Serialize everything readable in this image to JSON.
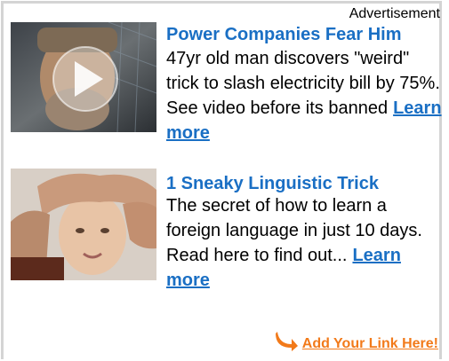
{
  "ad": {
    "label": "Advertisement",
    "items": [
      {
        "title": "Power Companies Fear Him",
        "body": "47yr old man discovers \"weird\" trick to slash electricity bill by 75%. See video before its banned",
        "cta": "Learn more",
        "thumbnail_icon": "play-icon"
      },
      {
        "title": "1 Sneaky Linguistic Trick",
        "body": "The secret of how to learn a foreign language in just 10 days. Read here to find out...",
        "cta": "Learn more"
      }
    ],
    "footer_link": "Add Your Link Here!"
  },
  "colors": {
    "link_blue": "#1a6fc4",
    "accent_orange": "#f27a1a",
    "frame_gray": "#d4d4d4"
  }
}
